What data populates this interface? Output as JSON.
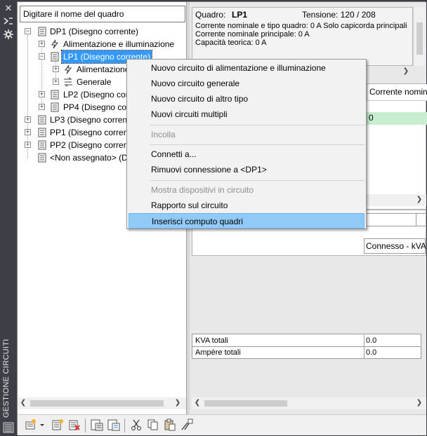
{
  "palette": {
    "title": "GESTIONE CIRCUITI"
  },
  "search": {
    "placeholder": "Digitare il nome del quadro"
  },
  "tree": {
    "items": [
      {
        "label": "DP1 (Disegno corrente)"
      },
      {
        "label": "Alimentazione e illuminazione"
      },
      {
        "label": "LP1 (Disegno corrente)"
      },
      {
        "label": "Alimentazione"
      },
      {
        "label": "Generale"
      },
      {
        "label": "LP2 (Disegno cor"
      },
      {
        "label": "PP4 (Disegno cor"
      },
      {
        "label": "LP3 (Disegno corrent"
      },
      {
        "label": "PP1 (Disegno corrent"
      },
      {
        "label": "PP2 (Disegno corrent"
      },
      {
        "label": "<Non assegnato> (D"
      }
    ]
  },
  "info": {
    "quadro_label": "Quadro:",
    "quadro_value": "LP1",
    "tensione_label": "Tensione: 120 / 208",
    "line1": "Corrente nominale e tipo quadro: 0 A Solo capicorda principali",
    "line2": "Corrente nominale principale: 0 A",
    "line3": "Capacità teorica: 0 A"
  },
  "grid": {
    "header": "Corrente nomin",
    "green_cell": "0"
  },
  "table2": {
    "header": "Connesso - kVA"
  },
  "totals": {
    "rows": [
      {
        "label": "KVA totali",
        "value": "0.0"
      },
      {
        "label": "Ampère totali",
        "value": "0.0"
      }
    ]
  },
  "context_menu": {
    "items": [
      {
        "label": "Nuovo circuito di alimentazione e illuminazione"
      },
      {
        "label": "Nuovo circuito generale"
      },
      {
        "label": "Nuovo circuito di altro tipo"
      },
      {
        "label": "Nuovi circuiti multipli"
      },
      {
        "label": "Incolla"
      },
      {
        "label": "Connetti a..."
      },
      {
        "label": "Rimuovi connessione a <DP1>"
      },
      {
        "label": "Mostra dispositivi in circuito"
      },
      {
        "label": "Rapporto sul circuito"
      },
      {
        "label": "Inserisci computo quadri"
      }
    ]
  },
  "colors": {
    "selection": "#3399ff",
    "menu_highlight": "#91c9f7",
    "green_cell": "#c6eecf",
    "titlebar": "#3c3f45"
  }
}
